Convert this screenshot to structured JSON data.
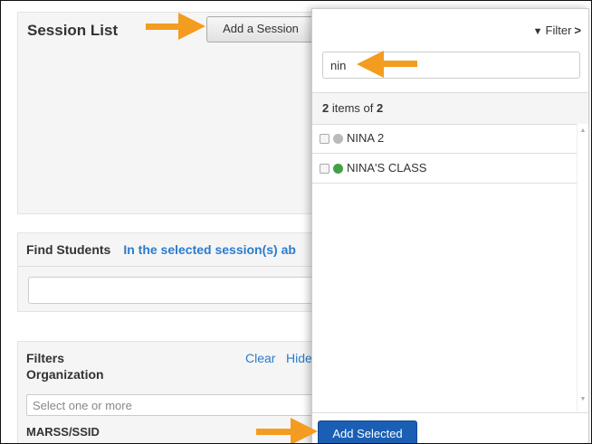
{
  "session_list": {
    "title": "Session List",
    "add_session_label": "Add a Session"
  },
  "find_students": {
    "label": "Find Students",
    "selected_text": "In the selected session(s) ab"
  },
  "filters": {
    "title": "Filters",
    "clear_label": "Clear",
    "hide_label": "Hide",
    "organization_label": "Organization",
    "organization_placeholder": "Select one or more",
    "marss_label": "MARSS/SSID"
  },
  "popup": {
    "filter_label": "Filter",
    "search_value": "nin",
    "count_shown": "2",
    "count_middle": " items of ",
    "count_total": "2",
    "items": [
      {
        "label": "NINA 2",
        "status_color": "#bbbbbb"
      },
      {
        "label": "NINA'S CLASS",
        "status_color": "#43a047"
      }
    ],
    "add_selected_label": "Add Selected"
  },
  "colors": {
    "annotation_arrow": "#f39c1f",
    "link": "#2a7ccc",
    "primary_button": "#1a5fb4"
  }
}
